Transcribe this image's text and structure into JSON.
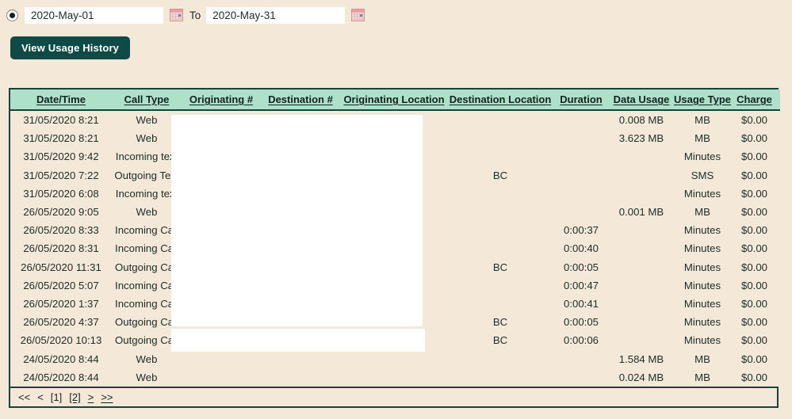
{
  "colors": {
    "page_background": "#f4e8d8",
    "table_border": "#17433d",
    "header_background": "#aee0ca",
    "button_background": "#104a46",
    "button_text": "#ffffff",
    "text": "#1d2d28"
  },
  "filter": {
    "radio_selected": true,
    "radio_name": "date-range-radio",
    "from_value": "2020-May-01",
    "from_placeholder": "yyyy-Mmm-dd",
    "to_separator": "To",
    "to_value": "2020-May-31",
    "to_placeholder": "yyyy-Mmm-dd",
    "from_calendar_icon": "calendar-icon",
    "to_calendar_icon": "calendar-icon",
    "submit_label": "View Usage History"
  },
  "table": {
    "columns": [
      "Date/Time",
      "Call Type",
      "Originating #",
      "Destination #",
      "Originating Location",
      "Destination Location",
      "Duration",
      "Data Usage",
      "Usage Type",
      "Charge"
    ],
    "rows": [
      {
        "datetime": "31/05/2020 8:21",
        "call_type": "Web",
        "originating_number": "",
        "destination_number": "",
        "originating_location": "",
        "destination_location": "",
        "duration": "",
        "data_usage": "0.008 MB",
        "usage_type": "MB",
        "charge": "$0.00"
      },
      {
        "datetime": "31/05/2020 8:21",
        "call_type": "Web",
        "originating_number": "",
        "destination_number": "",
        "originating_location": "",
        "destination_location": "",
        "duration": "",
        "data_usage": "3.623 MB",
        "usage_type": "MB",
        "charge": "$0.00"
      },
      {
        "datetime": "31/05/2020 9:42",
        "call_type": "Incoming text",
        "originating_number": "",
        "destination_number": "",
        "originating_location": "",
        "destination_location": "",
        "duration": "",
        "data_usage": "",
        "usage_type": "Minutes",
        "charge": "$0.00"
      },
      {
        "datetime": "31/05/2020 7:22",
        "call_type": "Outgoing Text",
        "originating_number": "",
        "destination_number": "",
        "originating_location": "",
        "destination_location": "BC",
        "duration": "",
        "data_usage": "",
        "usage_type": "SMS",
        "charge": "$0.00"
      },
      {
        "datetime": "31/05/2020 6:08",
        "call_type": "Incoming text",
        "originating_number": "",
        "destination_number": "",
        "originating_location": "",
        "destination_location": "",
        "duration": "",
        "data_usage": "",
        "usage_type": "Minutes",
        "charge": "$0.00"
      },
      {
        "datetime": "26/05/2020 9:05",
        "call_type": "Web",
        "originating_number": "",
        "destination_number": "",
        "originating_location": "",
        "destination_location": "",
        "duration": "",
        "data_usage": "0.001 MB",
        "usage_type": "MB",
        "charge": "$0.00"
      },
      {
        "datetime": "26/05/2020 8:33",
        "call_type": "Incoming Call",
        "originating_number": "",
        "destination_number": "",
        "originating_location": "",
        "destination_location": "",
        "duration": "0:00:37",
        "data_usage": "",
        "usage_type": "Minutes",
        "charge": "$0.00"
      },
      {
        "datetime": "26/05/2020 8:31",
        "call_type": "Incoming Call",
        "originating_number": "",
        "destination_number": "",
        "originating_location": "",
        "destination_location": "",
        "duration": "0:00:40",
        "data_usage": "",
        "usage_type": "Minutes",
        "charge": "$0.00"
      },
      {
        "datetime": "26/05/2020 11:31",
        "call_type": "Outgoing Call",
        "originating_number": "",
        "destination_number": "",
        "originating_location": "",
        "destination_location": "BC",
        "duration": "0:00:05",
        "data_usage": "",
        "usage_type": "Minutes",
        "charge": "$0.00"
      },
      {
        "datetime": "26/05/2020 5:07",
        "call_type": "Incoming Call",
        "originating_number": "",
        "destination_number": "",
        "originating_location": "",
        "destination_location": "",
        "duration": "0:00:47",
        "data_usage": "",
        "usage_type": "Minutes",
        "charge": "$0.00"
      },
      {
        "datetime": "26/05/2020 1:37",
        "call_type": "Incoming Call",
        "originating_number": "",
        "destination_number": "",
        "originating_location": "",
        "destination_location": "",
        "duration": "0:00:41",
        "data_usage": "",
        "usage_type": "Minutes",
        "charge": "$0.00"
      },
      {
        "datetime": "26/05/2020 4:37",
        "call_type": "Outgoing Call",
        "originating_number": "",
        "destination_number": "",
        "originating_location": "",
        "destination_location": "BC",
        "duration": "0:00:05",
        "data_usage": "",
        "usage_type": "Minutes",
        "charge": "$0.00"
      },
      {
        "datetime": "26/05/2020 10:13",
        "call_type": "Outgoing Call",
        "originating_number": "",
        "destination_number": "",
        "originating_location": "",
        "destination_location": "BC",
        "duration": "0:00:06",
        "data_usage": "",
        "usage_type": "Minutes",
        "charge": "$0.00"
      },
      {
        "datetime": "24/05/2020 8:44",
        "call_type": "Web",
        "originating_number": "",
        "destination_number": "",
        "originating_location": "",
        "destination_location": "",
        "duration": "",
        "data_usage": "1.584 MB",
        "usage_type": "MB",
        "charge": "$0.00"
      },
      {
        "datetime": "24/05/2020 8:44",
        "call_type": "Web",
        "originating_number": "",
        "destination_number": "",
        "originating_location": "",
        "destination_location": "",
        "duration": "",
        "data_usage": "0.024 MB",
        "usage_type": "MB",
        "charge": "$0.00"
      }
    ]
  },
  "pager": {
    "first": "<<",
    "prev": "<",
    "page_1": "[1]",
    "page_2": "[2]",
    "next": ">",
    "last": ">>"
  }
}
